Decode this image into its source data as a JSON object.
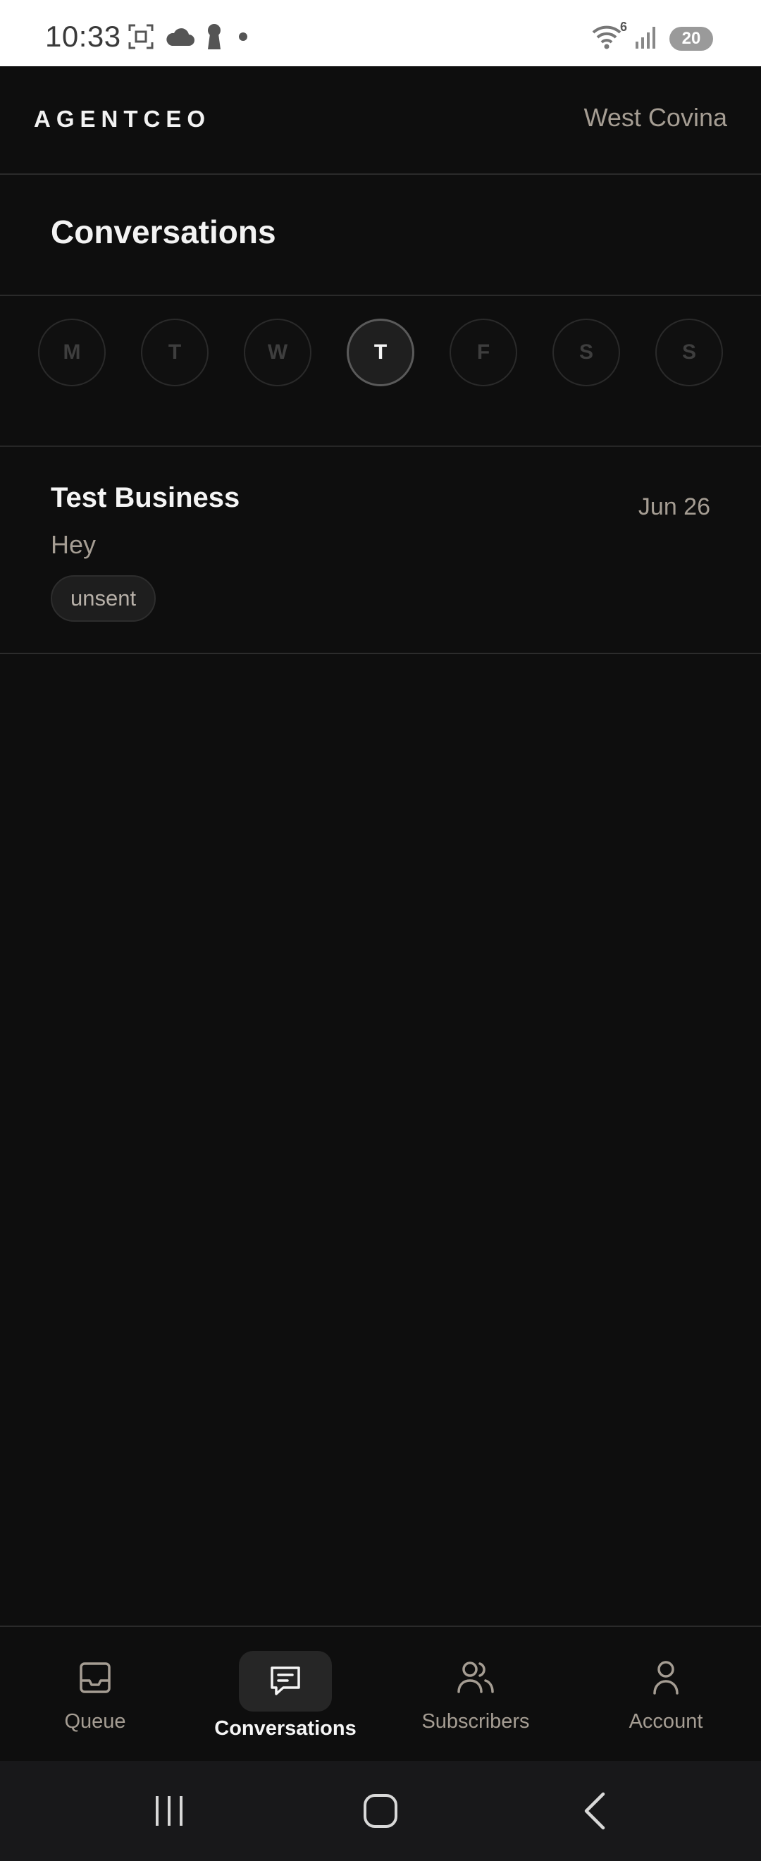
{
  "status_bar": {
    "time": "10:33",
    "wifi_badge": "6",
    "battery": "20",
    "icons": [
      "screenshot-icon",
      "cloud-icon",
      "keyhole-icon",
      "dot-icon",
      "wifi-icon",
      "signal-icon",
      "battery-icon"
    ]
  },
  "app_bar": {
    "brand": "AGENTCEO",
    "location": "West Covina"
  },
  "page": {
    "title": "Conversations"
  },
  "days": {
    "items": [
      "M",
      "T",
      "W",
      "T",
      "F",
      "S",
      "S"
    ],
    "active_index": 3
  },
  "conversations": [
    {
      "name": "Test Business",
      "message": "Hey",
      "date": "Jun 26",
      "status": "unsent"
    }
  ],
  "bottom_nav": {
    "items": [
      {
        "label": "Queue",
        "icon": "inbox-icon",
        "active": false
      },
      {
        "label": "Conversations",
        "icon": "chat-icon",
        "active": true
      },
      {
        "label": "Subscribers",
        "icon": "users-icon",
        "active": false
      },
      {
        "label": "Account",
        "icon": "user-icon",
        "active": false
      }
    ]
  },
  "colors": {
    "background": "#0e0e0e",
    "muted_text": "#a59d93",
    "primary_text": "#f5f5f5",
    "divider": "#2a2a2a"
  }
}
